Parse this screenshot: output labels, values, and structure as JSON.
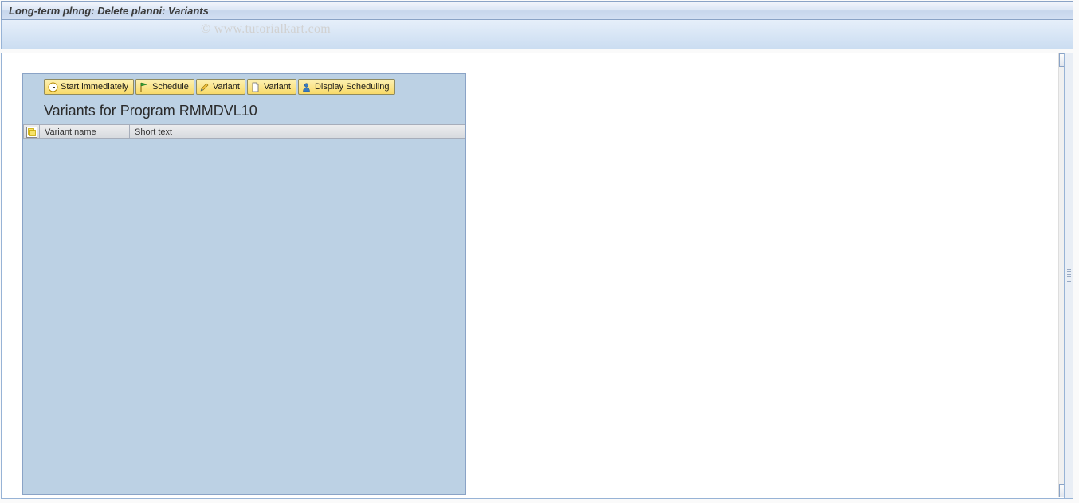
{
  "title_bar": {
    "text": "Long-term plnng: Delete planni: Variants"
  },
  "watermark": "© www.tutorialkart.com",
  "toolbar": {
    "buttons": {
      "start_label": "Start immediately",
      "schedule_label": "Schedule",
      "variant_edit_label": "Variant",
      "variant_new_label": "Variant",
      "display_sched_label": "Display Scheduling"
    }
  },
  "section": {
    "heading": "Variants for Program RMMDVL10"
  },
  "table": {
    "columns": {
      "variant_name": "Variant name",
      "short_text": "Short text"
    }
  }
}
